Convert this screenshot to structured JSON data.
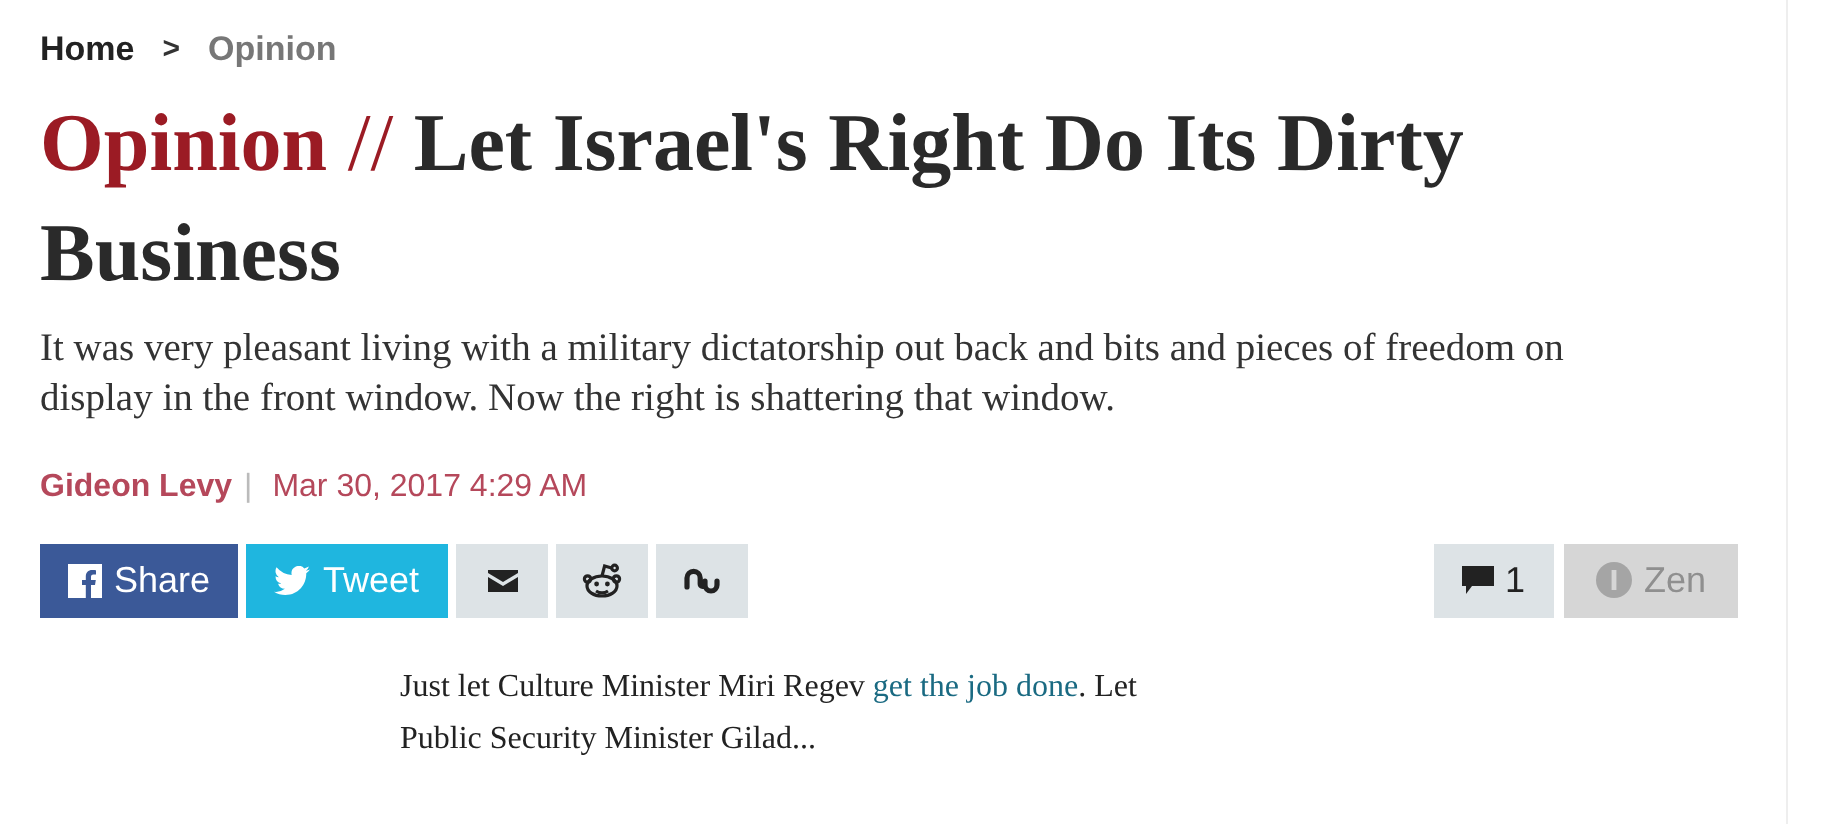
{
  "breadcrumb": [
    {
      "label": "Home",
      "kind": "link"
    },
    {
      "label": ">",
      "kind": "separator"
    },
    {
      "label": "Opinion",
      "kind": "current"
    }
  ],
  "headline": {
    "section": "Opinion",
    "separator": "//",
    "title": "Let Israel's Right Do Its Dirty Business"
  },
  "subtitle": "It was very pleasant living with a military dictatorship out back and bits and pieces of freedom on display in the front window. Now the right is shattering that window.",
  "byline": {
    "author": "Gideon Levy",
    "separator": "|",
    "date": "Mar 30, 2017 4:29 AM"
  },
  "share_buttons": [
    {
      "kind": "facebook",
      "label": "Share"
    },
    {
      "kind": "twitter",
      "label": "Tweet"
    },
    {
      "kind": "email"
    },
    {
      "kind": "reddit"
    },
    {
      "kind": "stumbleupon"
    }
  ],
  "comments": {
    "count": "1"
  },
  "zen": {
    "label": "Zen",
    "disabled": true
  },
  "body": {
    "before": "Just let Culture Minister Miri Regev ",
    "link": "get the job done",
    "after": ". Let Public Security Minister Gilad..."
  }
}
